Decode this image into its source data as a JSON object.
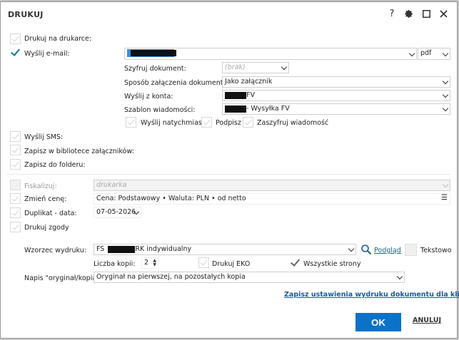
{
  "dialog": {
    "title": "DRUKUJ",
    "help_label": "?"
  },
  "options": {
    "print_on_printer": {
      "label": "Drukuj na drukarce:",
      "checked": false
    },
    "send_email": {
      "label": "Wyślij e-mail:",
      "checked": true
    },
    "send_sms": {
      "label": "Wyślij SMS:"
    },
    "save_attachments": {
      "label": "Zapisz w bibliotece załączników:"
    },
    "save_folder": {
      "label": "Zapisz do folderu:"
    },
    "fiscalize": {
      "label": "Fiskalizuj:",
      "placeholder": "drukarka"
    },
    "change_price": {
      "label": "Zmień cenę:",
      "value": "Cena: Podstawowy • Waluta: PLN • od netto",
      "menu_glyph": "☰"
    },
    "duplicate_date": {
      "label": "Duplikat - data:",
      "value": "07-05-2026"
    },
    "print_consents": {
      "label": "Drukuj zgody"
    }
  },
  "email": {
    "format": "pdf",
    "encrypt_label": "Szyfruj dokument:",
    "encrypt_value": "(brak)",
    "attach_method_label": "Sposób załączenia dokumentu:",
    "attach_method_value": "Jako załącznik",
    "from_account_label": "Wyślij z konta:",
    "from_account_value": "FV",
    "template_label": "Szablon wiadomości:",
    "template_value": "- Wysyłka FV",
    "send_now_label": "Wyślij natychmiast",
    "sign_label": "Podpisz",
    "encrypt_message_label": "Zaszyfruj wiadomość"
  },
  "print_template": {
    "label": "Wzorzec wydruku:",
    "value_prefix": "FS",
    "value_suffix": "RK indywidualny",
    "preview_label": "Podgląd",
    "text_label": "Tekstowo",
    "copies_label": "Liczba kopii:",
    "copies_value": "2",
    "eco_label": "Drukuj EKO",
    "all_pages_label": "Wszystkie strony",
    "caption_label": "Napis \"oryginał/kopia\":",
    "caption_value": "Oryginał na pierwszej, na pozostałych kopia",
    "save_settings_link": "Zapisz ustawienia wydruku dokumentu dla klienta"
  },
  "buttons": {
    "ok": "OK",
    "cancel": "ANULUJ"
  },
  "colors": {
    "accent": "#0a73c8",
    "link": "#1d5b9a"
  }
}
